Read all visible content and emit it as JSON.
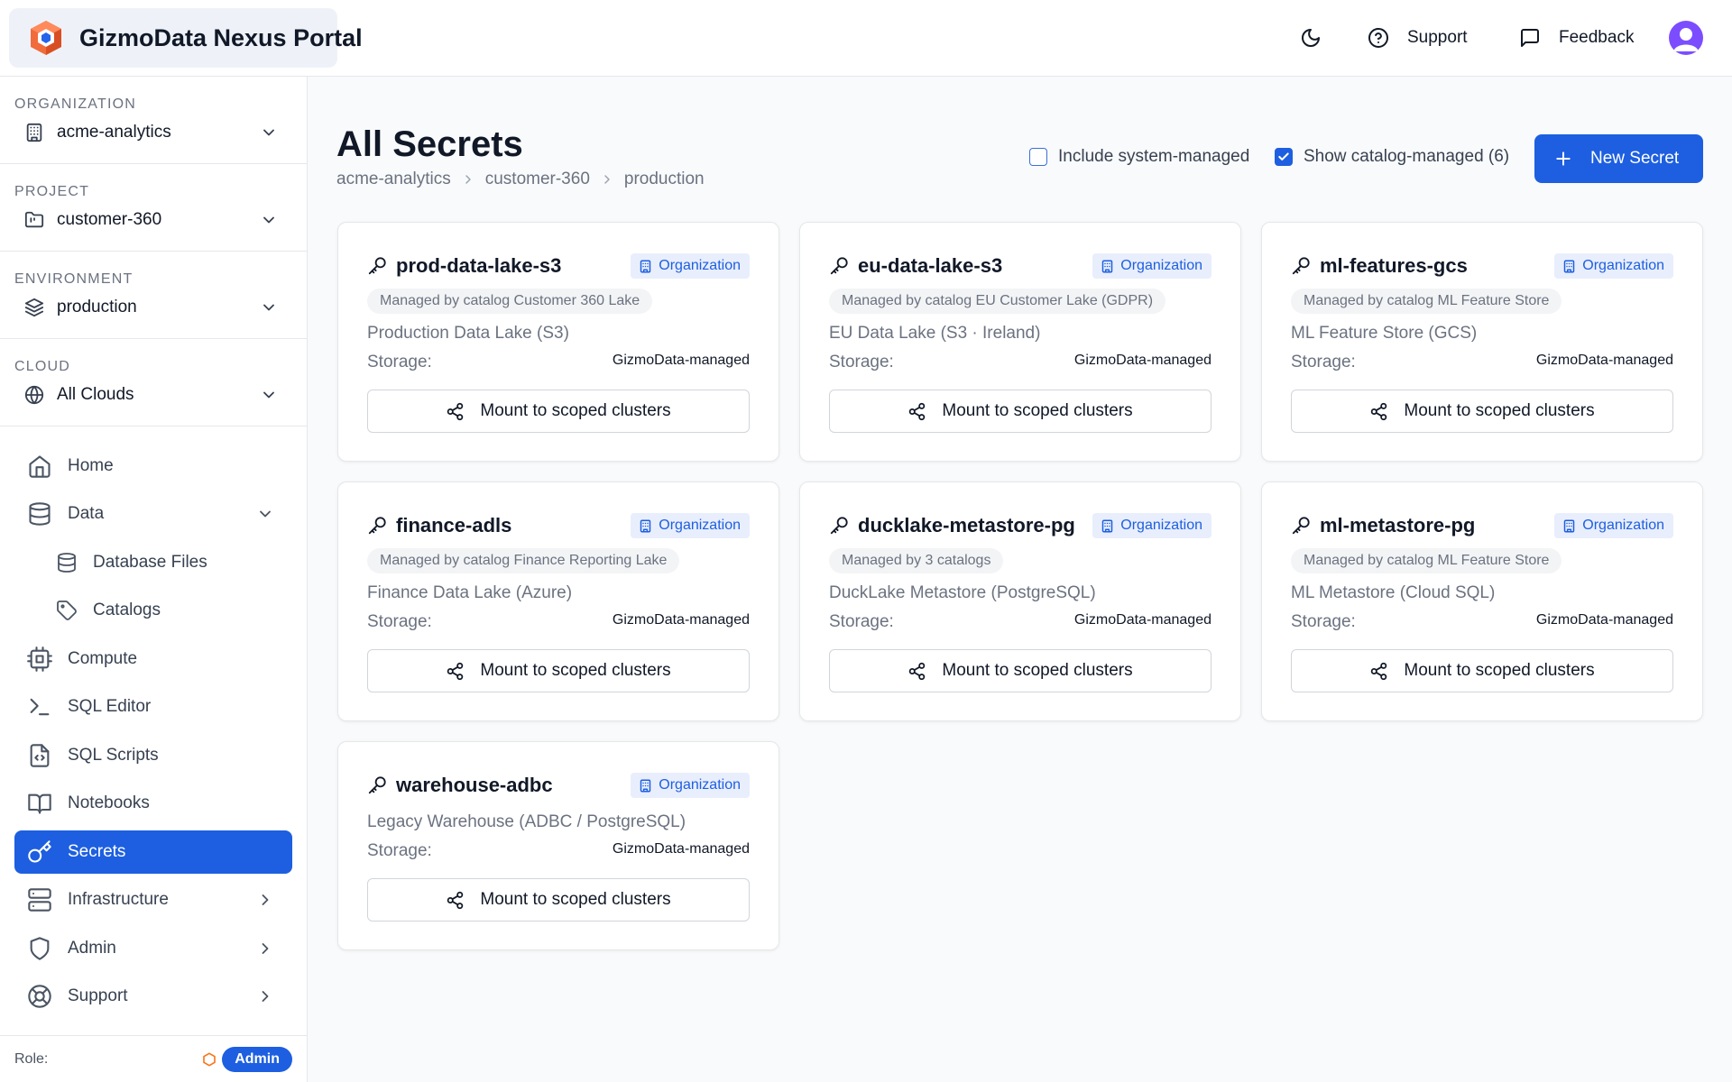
{
  "app": {
    "title": "GizmoData Nexus Portal"
  },
  "topbar": {
    "support_label": "Support",
    "feedback_label": "Feedback"
  },
  "sidebar": {
    "scopes": [
      {
        "label": "ORGANIZATION",
        "value": "acme-analytics",
        "icon": "building-icon"
      },
      {
        "label": "PROJECT",
        "value": "customer-360",
        "icon": "folder-icon"
      },
      {
        "label": "ENVIRONMENT",
        "value": "production",
        "icon": "layers-icon"
      },
      {
        "label": "CLOUD",
        "value": "All Clouds",
        "icon": "globe-icon"
      }
    ],
    "nav": [
      {
        "label": "Home",
        "icon": "home-icon"
      },
      {
        "label": "Data",
        "icon": "database-icon",
        "expanded": true
      },
      {
        "label": "Database Files",
        "icon": "database-icon"
      },
      {
        "label": "Catalogs",
        "icon": "tag-icon"
      },
      {
        "label": "Compute",
        "icon": "cpu-icon"
      },
      {
        "label": "SQL Editor",
        "icon": "terminal-icon"
      },
      {
        "label": "SQL Scripts",
        "icon": "file-code-icon"
      },
      {
        "label": "Notebooks",
        "icon": "book-icon"
      },
      {
        "label": "Secrets",
        "icon": "key-icon",
        "active": true
      },
      {
        "label": "Infrastructure",
        "icon": "server-icon"
      },
      {
        "label": "Admin",
        "icon": "shield-icon"
      },
      {
        "label": "Support",
        "icon": "lifebuoy-icon"
      }
    ],
    "role_label": "Role:",
    "role_value": "Admin"
  },
  "main": {
    "title": "All Secrets",
    "breadcrumb": [
      "acme-analytics",
      "customer-360",
      "production"
    ],
    "filters": {
      "include_system_label": "Include system-managed",
      "include_system_checked": false,
      "show_catalog_label": "Show catalog-managed (6)",
      "show_catalog_checked": true
    },
    "new_secret_label": "New Secret",
    "storage_label": "Storage:",
    "mount_label": "Mount to scoped clusters",
    "scope_badge": "Organization",
    "secrets": [
      {
        "name": "prod-data-lake-s3",
        "managed": "Managed by catalog Customer 360 Lake",
        "description": "Production Data Lake (S3)",
        "storage": "GizmoData-managed"
      },
      {
        "name": "eu-data-lake-s3",
        "managed": "Managed by catalog EU Customer Lake (GDPR)",
        "description": "EU Data Lake (S3 · Ireland)",
        "storage": "GizmoData-managed"
      },
      {
        "name": "ml-features-gcs",
        "managed": "Managed by catalog ML Feature Store",
        "description": "ML Feature Store (GCS)",
        "storage": "GizmoData-managed"
      },
      {
        "name": "finance-adls",
        "managed": "Managed by catalog Finance Reporting Lake",
        "description": "Finance Data Lake (Azure)",
        "storage": "GizmoData-managed"
      },
      {
        "name": "ducklake-metastore-pg",
        "managed": "Managed by 3 catalogs",
        "description": "DuckLake Metastore (PostgreSQL)",
        "storage": "GizmoData-managed"
      },
      {
        "name": "ml-metastore-pg",
        "managed": "Managed by catalog ML Feature Store",
        "description": "ML Metastore (Cloud SQL)",
        "storage": "GizmoData-managed"
      },
      {
        "name": "warehouse-adbc",
        "managed": "",
        "description": "Legacy Warehouse (ADBC / PostgreSQL)",
        "storage": "GizmoData-managed"
      }
    ]
  },
  "colors": {
    "primary": "#1d5fe0",
    "badge_bg": "#e8eefc",
    "avatar": "#7c4dff",
    "role_icon": "#f97316"
  }
}
